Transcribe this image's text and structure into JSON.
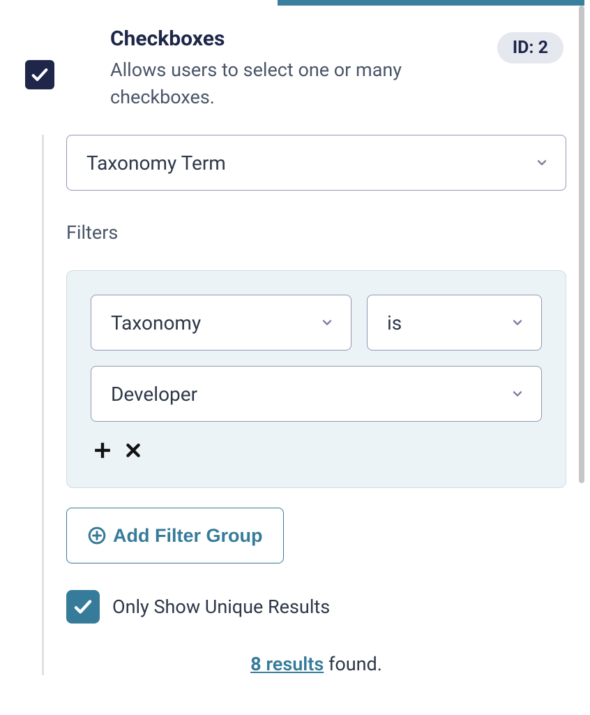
{
  "header": {
    "title": "Checkboxes",
    "description": "Allows users to select one or many checkboxes.",
    "id_label": "ID: 2"
  },
  "main_select": {
    "value": "Taxonomy Term"
  },
  "filters": {
    "label": "Filters",
    "group": {
      "field": "Taxonomy",
      "operator": "is",
      "value": "Developer"
    }
  },
  "add_filter_group": {
    "label": "Add Filter Group"
  },
  "unique": {
    "label": "Only Show Unique Results",
    "checked": true
  },
  "results": {
    "count": "8",
    "results_word": "results",
    "found_word": " found."
  }
}
